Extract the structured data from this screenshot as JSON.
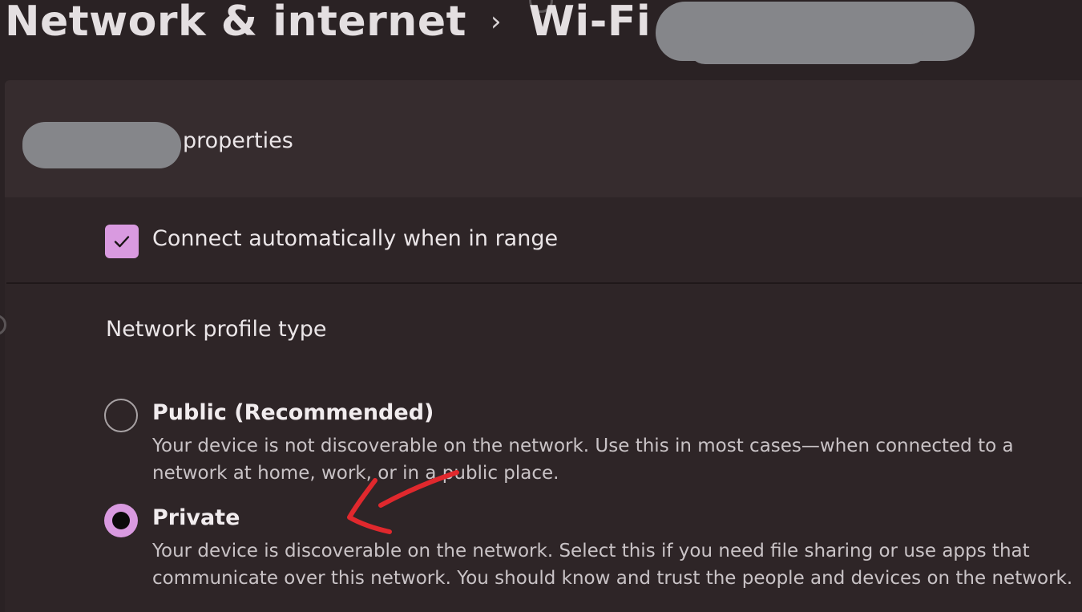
{
  "breadcrumb": {
    "items": [
      "Network & internet",
      "Wi-Fi"
    ],
    "separator": "›",
    "network_name_redacted": true
  },
  "properties_card": {
    "header_suffix": "properties",
    "name_redacted": true,
    "connect_auto": {
      "label": "Connect automatically when in range",
      "checked": true
    },
    "profile_type": {
      "label": "Network profile type",
      "options": [
        {
          "title": "Public (Recommended)",
          "description": "Your device is not discoverable on the network. Use this in most cases—when connected to a network at home, work, or in a public place.",
          "selected": false
        },
        {
          "title": "Private",
          "description": "Your device is discoverable on the network. Select this if you need file sharing or use apps that communicate over this network. You should know and trust the people and devices on the network.",
          "selected": true
        }
      ]
    }
  },
  "annotation": {
    "type": "hand-drawn arrow",
    "color": "#e0282d",
    "points_to": "Private"
  },
  "colors": {
    "accent": "#d99ae0",
    "background": "#2a2224",
    "header_bg": "#362c2e",
    "redaction": "#85868a"
  },
  "icons": {
    "checkbox_mark": "checkmark-icon",
    "separator": "chevron-right-icon"
  }
}
